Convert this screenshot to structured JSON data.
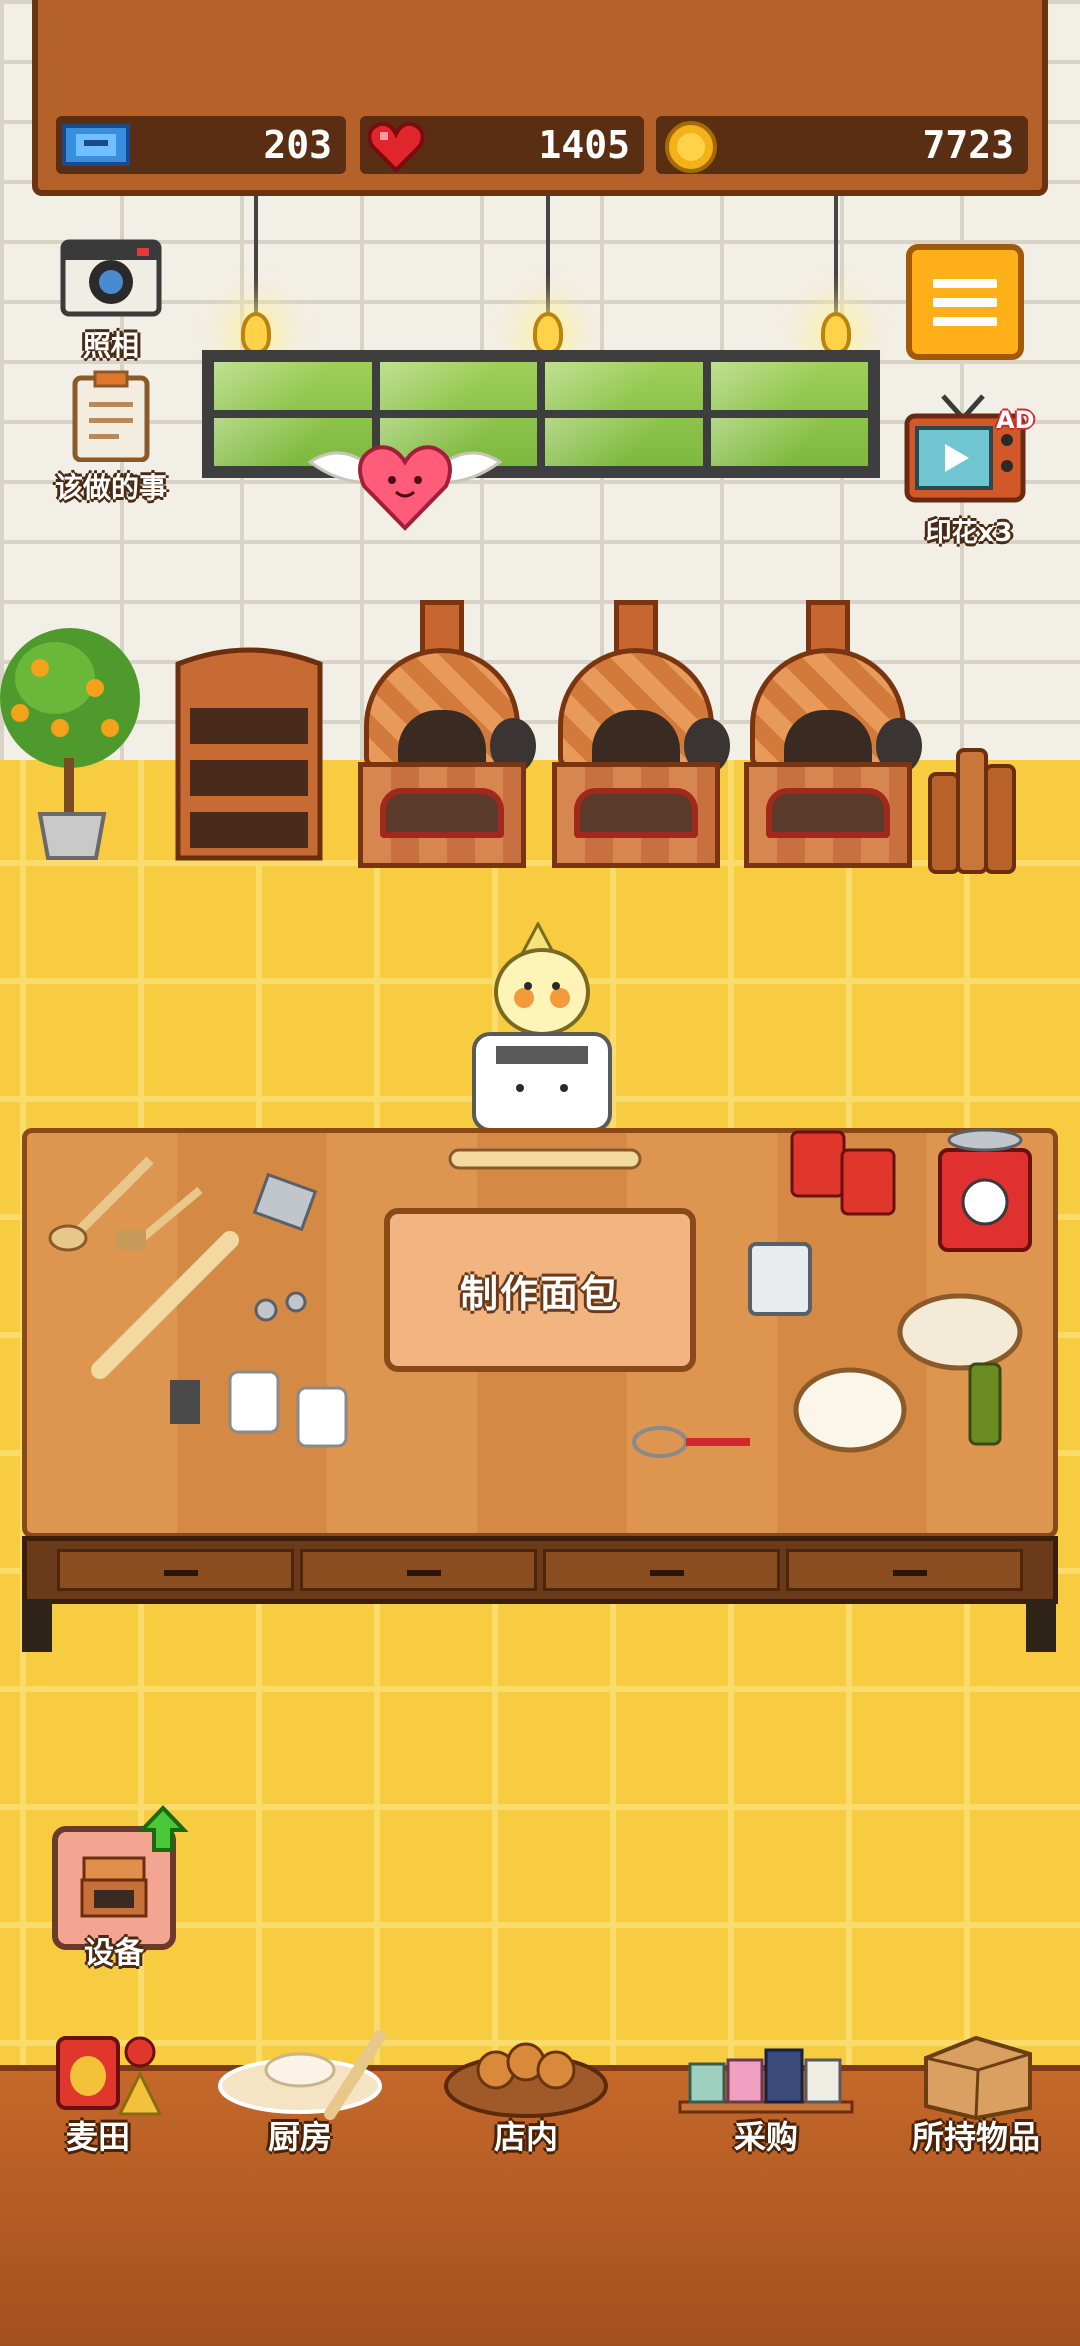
{
  "resources": {
    "tickets": "203",
    "hearts": "1405",
    "coins": "7723"
  },
  "side_buttons": {
    "camera_label": "照相",
    "todo_label": "该做的事",
    "ad_badge": "AD",
    "stamps_label": "印花x3"
  },
  "workbench": {
    "make_bread_label": "制作面包"
  },
  "equipment": {
    "label": "设备"
  },
  "nav": {
    "items": [
      {
        "label": "麦田"
      },
      {
        "label": "厨房"
      },
      {
        "label": "店内"
      },
      {
        "label": "采购"
      },
      {
        "label": "所持物品"
      }
    ]
  },
  "colors": {
    "accent": "#ffb018",
    "wood": "#b4622a",
    "floor": "#f7cc40"
  }
}
